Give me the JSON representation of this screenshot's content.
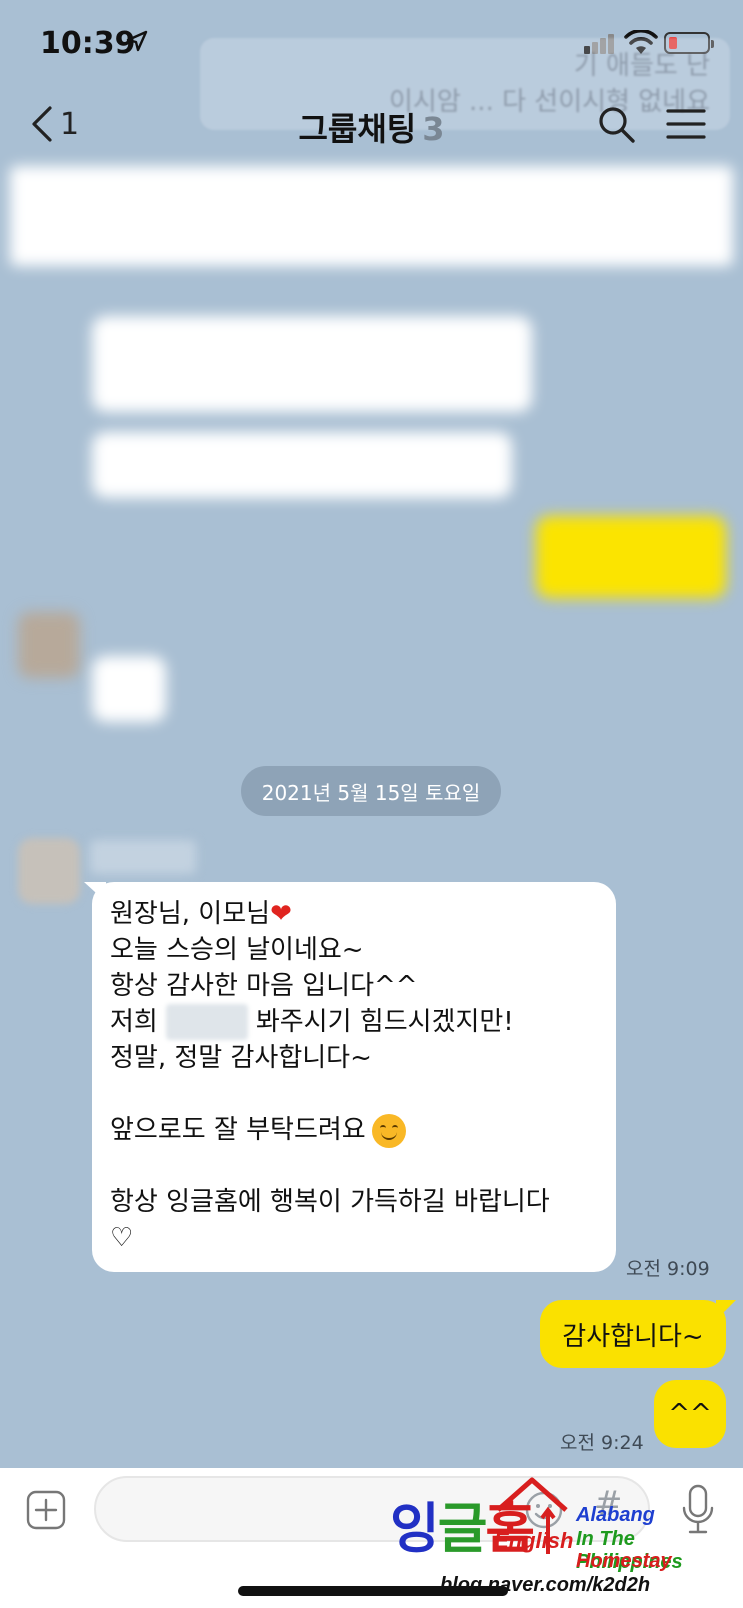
{
  "status_bar": {
    "time": "10:39",
    "battery_color": "#e53935"
  },
  "header": {
    "back_count": "1",
    "title": "그룹채팅",
    "member_count": "3",
    "ghost_text_line1": "기 애들도 난",
    "ghost_text_line2": "이시암 ... 다 선이시형 없네요"
  },
  "chat": {
    "date_divider": "2021년 5월 15일 토요일",
    "incoming": {
      "lines": {
        "l1": "원장님, 이모님",
        "l2": "오늘 스승의 날이네요~",
        "l3": "항상 감사한 마음 입니다^^",
        "l4_before": "저희",
        "l4_after": "봐주시기 힘드시겠지만!",
        "l5": "정말, 정말 감사합니다~",
        "l6": "앞으로도 잘 부탁드려요",
        "l7": "항상 잉글홈에 행복이 가득하길  바랍니다",
        "l8": "♡"
      },
      "time": "오전 9:09"
    },
    "outgoing": [
      {
        "text": "감사합니다~"
      },
      {
        "text": "^^"
      }
    ],
    "outgoing_time": "오전 9:24"
  },
  "input": {
    "placeholder": "",
    "hash_label": "#"
  },
  "watermark": {
    "k1": "잉",
    "k2": "글",
    "k3": "홈",
    "english": "English",
    "line1": "Alabang",
    "line2": "In The Philippines",
    "line3": "Homestay",
    "url": "blog.naver.com/k2d2h"
  },
  "colors": {
    "background": "#a9bfd3",
    "my_bubble": "#fae100",
    "other_bubble": "#ffffff"
  }
}
